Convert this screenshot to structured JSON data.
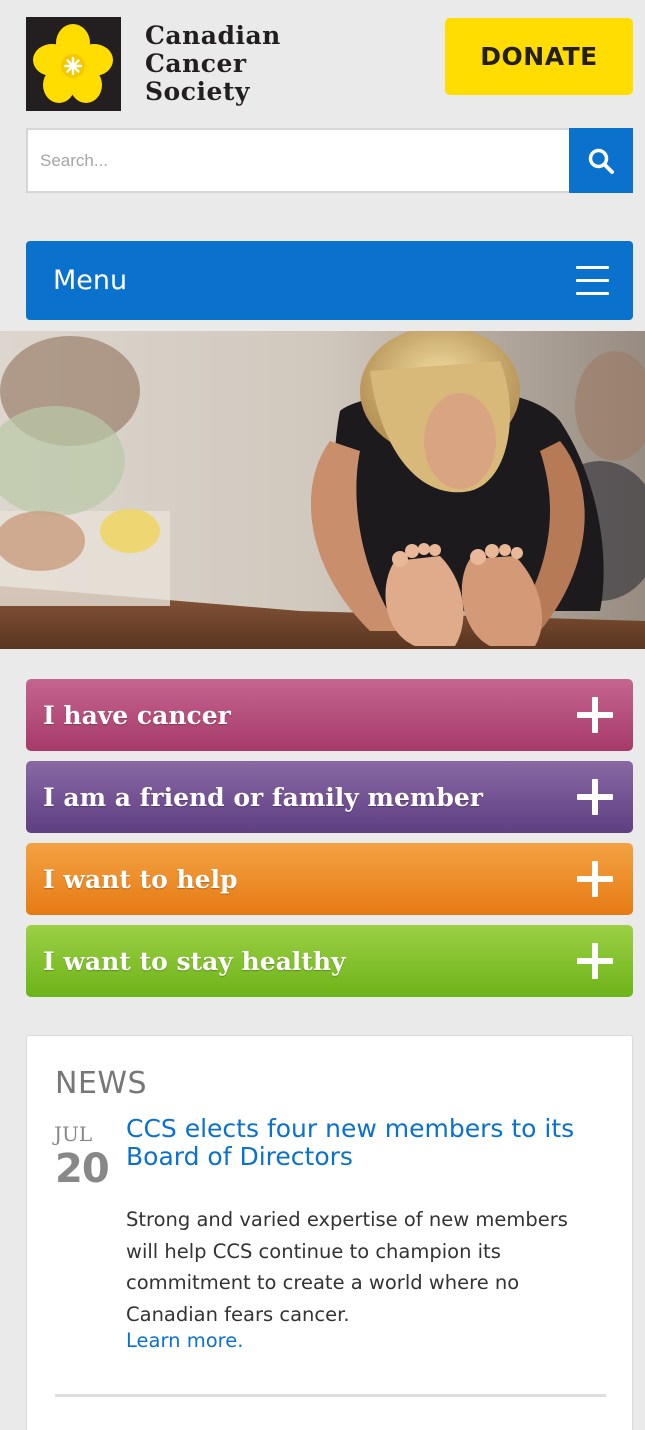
{
  "header": {
    "logo_lines": [
      "Canadian",
      "Cancer",
      "Society"
    ],
    "logo_icon": "daffodil-icon",
    "donate_label": "DONATE"
  },
  "search": {
    "placeholder": "Search...",
    "value": "",
    "button_icon": "search-icon"
  },
  "menu": {
    "label": "Menu",
    "icon": "hamburger-icon"
  },
  "accordions": [
    {
      "label": "I have cancer",
      "color": "#b04a78",
      "icon": "plus-icon"
    },
    {
      "label": "I am a friend or family member",
      "color": "#6b4c8f",
      "icon": "plus-icon"
    },
    {
      "label": "I want to help",
      "color": "#ec8a22",
      "icon": "plus-icon"
    },
    {
      "label": "I want to stay healthy",
      "color": "#7fbf2c",
      "icon": "plus-icon"
    }
  ],
  "news": {
    "heading": "NEWS",
    "items": [
      {
        "month": "JUL",
        "day": "20",
        "title": "CCS elects four new members to its Board of Directors",
        "body": "Strong and varied expertise of new members will help CCS continue to champion its commitment to create a world where no Canadian fears cancer.",
        "link": "Learn more."
      }
    ]
  },
  "colors": {
    "brand_blue": "#0a72cc",
    "brand_yellow": "#ffdd00",
    "page_bg": "#eaeaea"
  }
}
